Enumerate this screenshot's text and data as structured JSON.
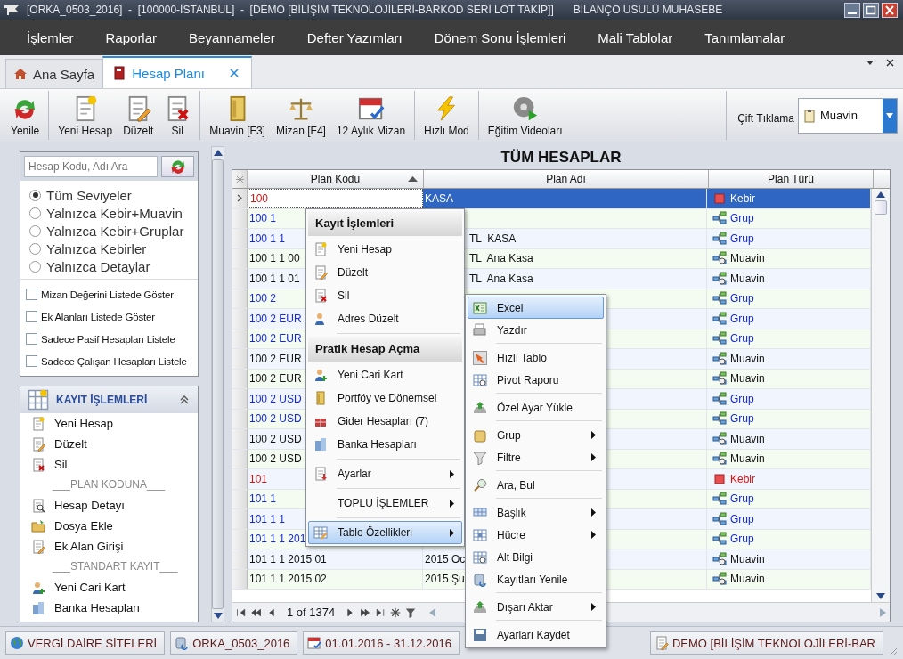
{
  "window": {
    "title": "[ORKA_0503_2016]  -  [100000-İSTANBUL]  -  [DEMO [BİLİŞİM TEKNOLOJİLERİ-BARKOD SERİ LOT TAKİP]]",
    "mode": "BİLANÇO USULÜ MUHASEBE"
  },
  "menu": [
    "İşlemler",
    "Raporlar",
    "Beyannameler",
    "Defter Yazımları",
    "Dönem Sonu İşlemleri",
    "Mali Tablolar",
    "Tanımlamalar"
  ],
  "tabs": [
    {
      "label": "Ana Sayfa",
      "selected": false
    },
    {
      "label": "Hesap Planı",
      "selected": true
    }
  ],
  "toolbar": {
    "groups": [
      [
        "Yenile"
      ],
      [
        "Yeni Hesap",
        "Düzelt",
        "Sil"
      ],
      [
        "Muavin [F3]",
        "Mizan [F4]",
        "12 Aylık Mizan"
      ],
      [
        "Hızlı Mod"
      ],
      [
        "Eğitim Videoları"
      ]
    ],
    "double_click": {
      "label": "Çift Tıklama",
      "value": "Muavin"
    }
  },
  "left_panel": {
    "search": {
      "placeholder": "Hesap Kodu, Adı Ara"
    },
    "levels": [
      {
        "label": "Tüm Seviyeler",
        "selected": true
      },
      {
        "label": "Yalnızca Kebir+Muavin",
        "selected": false
      },
      {
        "label": "Yalnızca Kebir+Gruplar",
        "selected": false
      },
      {
        "label": "Yalnızca Kebirler",
        "selected": false
      },
      {
        "label": "Yalnızca Detaylar",
        "selected": false
      }
    ],
    "options": [
      {
        "label": "Mizan Değerini Listede Göster",
        "checked": false
      },
      {
        "label": "Ek Alanları Listede Göster",
        "checked": false
      },
      {
        "label": "Sadece Pasif Hesapları Listele",
        "checked": false
      },
      {
        "label": "Sadece Çalışan Hesapları Listele",
        "checked": false
      }
    ],
    "section": {
      "title": "KAYIT İŞLEMLERİ",
      "expanded": true,
      "items": [
        {
          "kind": "item",
          "label": "Yeni Hesap"
        },
        {
          "kind": "item",
          "label": "Düzelt"
        },
        {
          "kind": "item",
          "label": "Sil"
        },
        {
          "kind": "heading",
          "label": "___PLAN KODUNA___"
        },
        {
          "kind": "item",
          "label": "Hesap Detayı"
        },
        {
          "kind": "item",
          "label": "Dosya Ekle"
        },
        {
          "kind": "item",
          "label": "Ek Alan Girişi"
        },
        {
          "kind": "heading",
          "label": "___STANDART KAYIT___"
        },
        {
          "kind": "item",
          "label": "Yeni Cari Kart"
        },
        {
          "kind": "item",
          "label": "Banka Hesapları"
        }
      ]
    }
  },
  "table": {
    "title": "TÜM HESAPLAR",
    "columns": [
      {
        "label": "Plan Kodu",
        "sorted": true
      },
      {
        "label": "Plan Adı",
        "sorted": false
      },
      {
        "label": "Plan Türü",
        "sorted": false
      }
    ],
    "rows": [
      {
        "code": "100",
        "name": "KASA",
        "kind": "kebir",
        "type": "Kebir",
        "selected": true
      },
      {
        "code": "100 1",
        "kind": "grup",
        "type": "Grup",
        "selected": false
      },
      {
        "code": "100 1 1",
        "name": "TL  KASA",
        "kind": "grup",
        "type": "Grup",
        "selected": false
      },
      {
        "code": "100 1 1 00",
        "name": "TL  Ana Kasa",
        "kind": "muavin",
        "type": "Muavin",
        "selected": false
      },
      {
        "code": "100 1 1 01",
        "name": "TL  Ana Kasa",
        "kind": "muavin",
        "type": "Muavin",
        "selected": false
      },
      {
        "code": "100 2",
        "kind": "grup",
        "type": "Grup",
        "selected": false
      },
      {
        "code": "100 2 EUR",
        "kind": "grup",
        "type": "Grup",
        "selected": false
      },
      {
        "code": "100 2 EUR",
        "kind": "grup",
        "type": "Grup",
        "selected": false
      },
      {
        "code": "100 2 EUR",
        "kind": "muavin",
        "type": "Muavin",
        "selected": false
      },
      {
        "code": "100 2 EUR",
        "kind": "muavin",
        "type": "Muavin",
        "selected": false
      },
      {
        "code": "100 2 USD",
        "kind": "grup",
        "type": "Grup",
        "selected": false
      },
      {
        "code": "100 2 USD",
        "kind": "grup",
        "type": "Grup",
        "selected": false
      },
      {
        "code": "100 2 USD",
        "kind": "muavin",
        "type": "Muavin",
        "selected": false
      },
      {
        "code": "100 2 USD",
        "kind": "muavin",
        "type": "Muavin",
        "selected": false
      },
      {
        "code": "101",
        "kind": "kebir",
        "type": "Kebir",
        "selected": false
      },
      {
        "code": "101 1",
        "kind": "grup",
        "type": "Grup",
        "selected": false
      },
      {
        "code": "101 1 1",
        "kind": "grup",
        "type": "Grup",
        "selected": false
      },
      {
        "code": "101 1 1 201",
        "kind": "grup",
        "type": "Grup",
        "selected": false
      },
      {
        "code": "101 1 1 2015 01",
        "name": "2015 Oc",
        "kind": "muavin",
        "type": "Muavin",
        "selected": false
      },
      {
        "code": "101 1 1 2015 02",
        "name": "2015 Şu",
        "kind": "muavin",
        "type": "Muavin",
        "selected": false
      }
    ],
    "pager": "1 of 1374"
  },
  "context_menu": {
    "items": [
      {
        "kind": "header",
        "label": "Kayıt İşlemleri"
      },
      {
        "kind": "item",
        "label": "Yeni Hesap",
        "selected": false,
        "submenu": false
      },
      {
        "kind": "item",
        "label": "Düzelt",
        "selected": false,
        "submenu": false
      },
      {
        "kind": "item",
        "label": "Sil",
        "selected": false,
        "submenu": false
      },
      {
        "kind": "item",
        "label": "Adres Düzelt",
        "selected": false,
        "submenu": false
      },
      {
        "kind": "separator"
      },
      {
        "kind": "header",
        "label": "Pratik Hesap Açma"
      },
      {
        "kind": "item",
        "label": "Yeni Cari Kart",
        "selected": false,
        "submenu": false
      },
      {
        "kind": "item",
        "label": "Portföy ve Dönemsel",
        "selected": false,
        "submenu": false
      },
      {
        "kind": "item",
        "label": "Gider Hesapları (7)",
        "selected": false,
        "submenu": false
      },
      {
        "kind": "item",
        "label": "Banka Hesapları",
        "selected": false,
        "submenu": false
      },
      {
        "kind": "separator"
      },
      {
        "kind": "item",
        "label": "Ayarlar",
        "selected": false,
        "submenu": true
      },
      {
        "kind": "separator"
      },
      {
        "kind": "item",
        "label": "TOPLU İŞLEMLER",
        "selected": false,
        "submenu": true
      },
      {
        "kind": "separator"
      },
      {
        "kind": "item",
        "label": "Tablo Özellikleri",
        "selected": true,
        "submenu": true
      }
    ]
  },
  "submenu": {
    "items": [
      {
        "kind": "item",
        "label": "Excel",
        "selected": true,
        "submenu": false
      },
      {
        "kind": "item",
        "label": "Yazdır",
        "selected": false,
        "submenu": false
      },
      {
        "kind": "separator"
      },
      {
        "kind": "item",
        "label": "Hızlı Tablo",
        "selected": false,
        "submenu": false
      },
      {
        "kind": "item",
        "label": "Pivot Raporu",
        "selected": false,
        "submenu": false
      },
      {
        "kind": "separator"
      },
      {
        "kind": "item",
        "label": "Özel Ayar Yükle",
        "selected": false,
        "submenu": false
      },
      {
        "kind": "separator"
      },
      {
        "kind": "item",
        "label": "Grup",
        "selected": false,
        "submenu": true
      },
      {
        "kind": "item",
        "label": "Filtre",
        "selected": false,
        "submenu": true
      },
      {
        "kind": "separator"
      },
      {
        "kind": "item",
        "label": "Ara, Bul",
        "selected": false,
        "submenu": false
      },
      {
        "kind": "separator"
      },
      {
        "kind": "item",
        "label": "Başlık",
        "selected": false,
        "submenu": true
      },
      {
        "kind": "item",
        "label": "Hücre",
        "selected": false,
        "submenu": true
      },
      {
        "kind": "item",
        "label": "Alt Bilgi",
        "selected": false,
        "submenu": false
      },
      {
        "kind": "item",
        "label": "Kayıtları Yenile",
        "selected": false,
        "submenu": false
      },
      {
        "kind": "separator"
      },
      {
        "kind": "item",
        "label": "Dışarı Aktar",
        "selected": false,
        "submenu": true
      },
      {
        "kind": "separator"
      },
      {
        "kind": "item",
        "label": "Ayarları Kaydet",
        "selected": false,
        "submenu": false
      }
    ]
  },
  "status_bar": [
    "VERGİ DAİRE SİTELERİ",
    "ORKA_0503_2016",
    "01.01.2016 - 31.12.2016",
    "DEMO [BİLİŞİM TEKNOLOJİLERİ-BAR"
  ]
}
